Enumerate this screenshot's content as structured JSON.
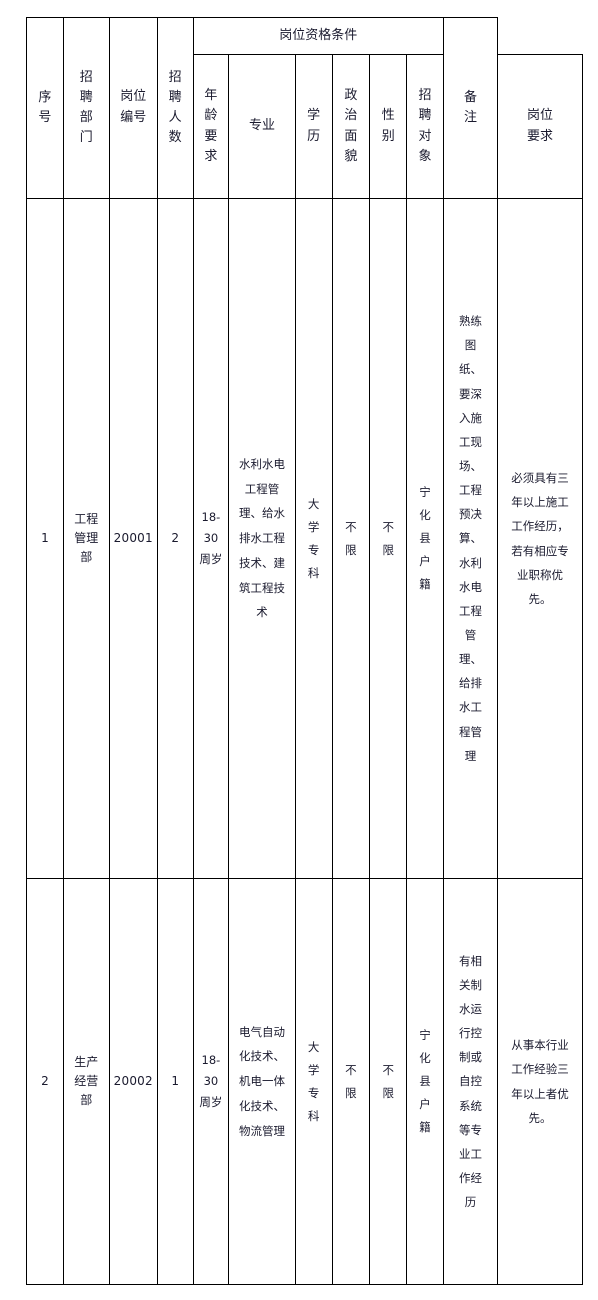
{
  "table": {
    "header": {
      "group_label": "岗位资格条件",
      "columns": [
        {
          "key": "seq",
          "label": "序号",
          "orientation": "vertical"
        },
        {
          "key": "dept",
          "label": "招聘部门",
          "orientation": "vertical"
        },
        {
          "key": "code",
          "label": "岗位编号",
          "orientation": "vertical2"
        },
        {
          "key": "num",
          "label": "招聘人数",
          "orientation": "vertical"
        },
        {
          "key": "age",
          "label": "年龄要求",
          "orientation": "vertical"
        },
        {
          "key": "major",
          "label": "专业",
          "orientation": "flat"
        },
        {
          "key": "edu",
          "label": "学历",
          "orientation": "vertical"
        },
        {
          "key": "pol",
          "label": "政治面貌",
          "orientation": "vertical"
        },
        {
          "key": "sex",
          "label": "性别",
          "orientation": "vertical"
        },
        {
          "key": "target",
          "label": "招聘对象",
          "orientation": "vertical"
        },
        {
          "key": "req",
          "label": "岗位要求",
          "orientation": "vertical2"
        },
        {
          "key": "note",
          "label": "备注",
          "orientation": "vertical"
        }
      ]
    },
    "rows": [
      {
        "seq": "1",
        "dept": "工程管理部",
        "code": "20001",
        "num": "2",
        "age": "18-30周岁",
        "major": "水利水电工程管理、给水排水工程技术、建筑工程技术",
        "edu": "大学专科",
        "pol": "不限",
        "sex": "不限",
        "target": "宁化县户籍",
        "req": "熟练图纸、要深入施工现场、工程预决算、水利水电工程管理、给排水工程管理",
        "note": "必须具有三年以上施工工作经历，若有相应专业职称优先。"
      },
      {
        "seq": "2",
        "dept": "生产经营部",
        "code": "20002",
        "num": "1",
        "age": "18-30周岁",
        "major": "电气自动化技术、机电一体化技术、物流管理",
        "edu": "大学专科",
        "pol": "不限",
        "sex": "不限",
        "target": "宁化县户籍",
        "req": "有相关制水运行控制或自控系统等专业工作经历",
        "note": "从事本行业工作经验三年以上者优先。"
      }
    ]
  },
  "colors": {
    "border": "#000000",
    "text": "#1a1a2e",
    "background": "#ffffff"
  }
}
